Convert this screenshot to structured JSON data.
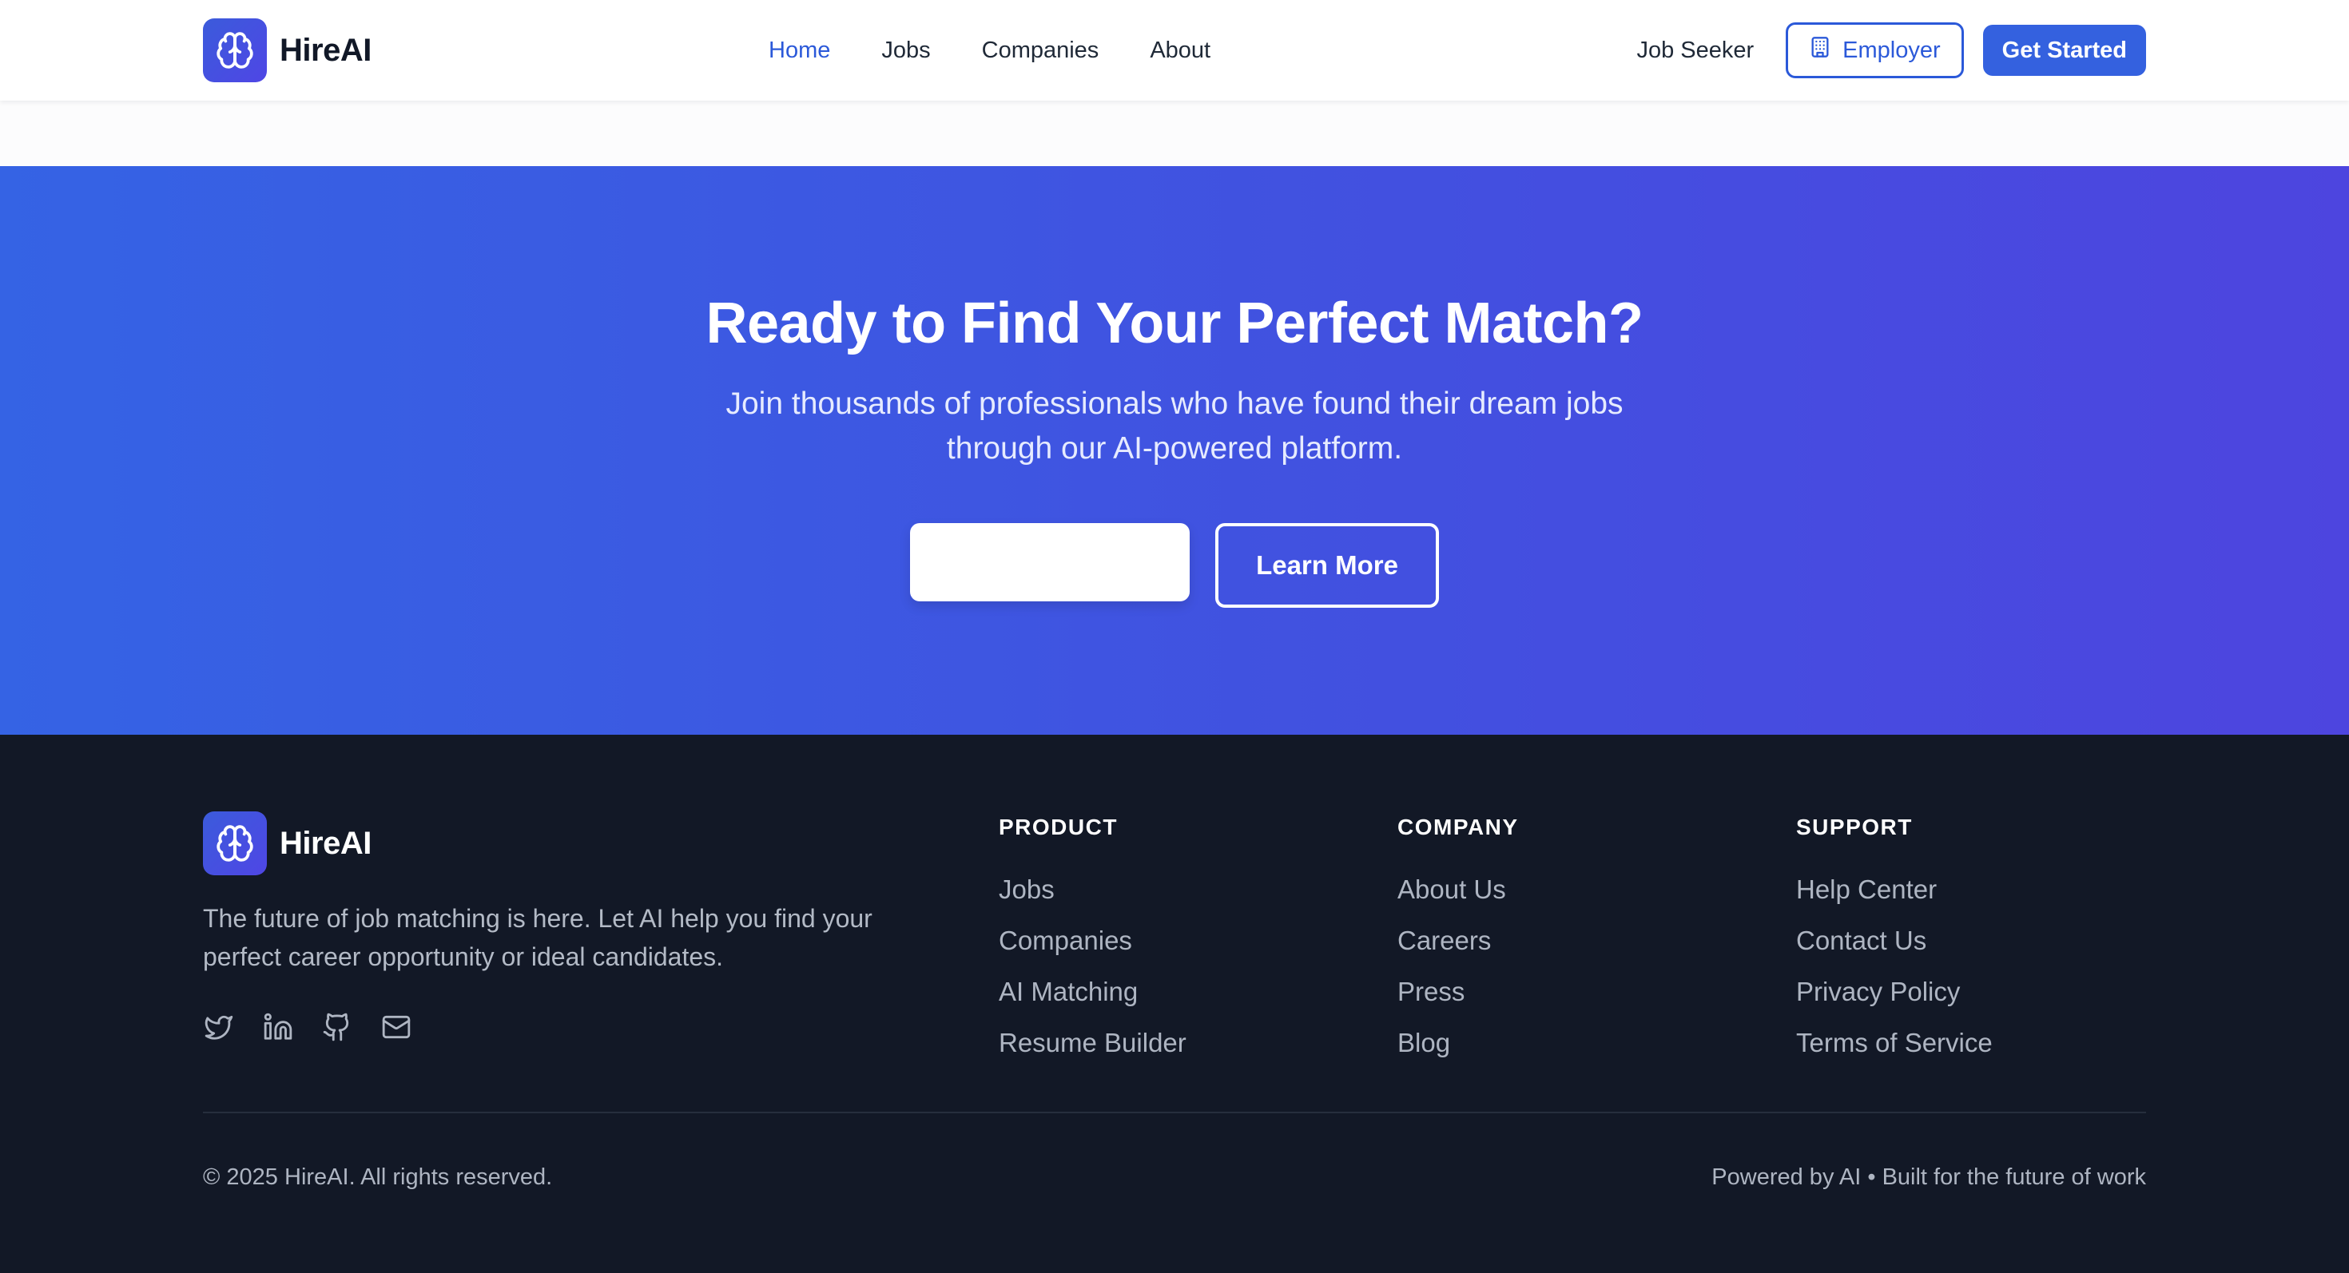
{
  "brand": {
    "name": "HireAI",
    "logo_icon": "brain-icon",
    "accent": "#3461df"
  },
  "nav": {
    "links": [
      {
        "label": "Home",
        "active": true
      },
      {
        "label": "Jobs",
        "active": false
      },
      {
        "label": "Companies",
        "active": false
      },
      {
        "label": "About",
        "active": false
      }
    ],
    "job_seeker": "Job Seeker",
    "employer": "Employer",
    "employer_icon": "building-icon",
    "get_started": "Get Started"
  },
  "cta": {
    "title": "Ready to Find Your Perfect Match?",
    "subtitle": "Join thousands of professionals who have found their dream jobs through our AI-powered platform.",
    "primary_button": "",
    "secondary_button": "Learn More"
  },
  "footer": {
    "brand": "HireAI",
    "tagline": "The future of job matching is here. Let AI help you find your perfect career opportunity or ideal candidates.",
    "socials": [
      "twitter-icon",
      "linkedin-icon",
      "github-icon",
      "mail-icon"
    ],
    "columns": [
      {
        "title": "PRODUCT",
        "items": [
          "Jobs",
          "Companies",
          "AI Matching",
          "Resume Builder"
        ]
      },
      {
        "title": "COMPANY",
        "items": [
          "About Us",
          "Careers",
          "Press",
          "Blog"
        ]
      },
      {
        "title": "SUPPORT",
        "items": [
          "Help Center",
          "Contact Us",
          "Privacy Policy",
          "Terms of Service"
        ]
      }
    ],
    "copyright": "© 2025 HireAI. All rights reserved.",
    "powered": "Powered by AI • Built for the future of work"
  }
}
